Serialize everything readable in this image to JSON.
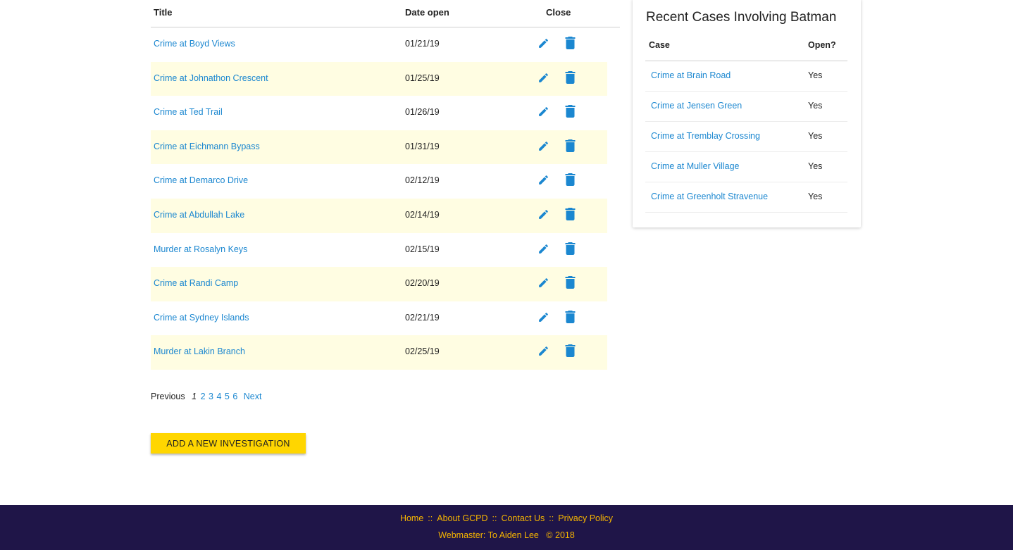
{
  "table": {
    "headers": {
      "title": "Title",
      "date": "Date open",
      "close": "Close"
    },
    "rows": [
      {
        "title": "Crime at Boyd Views",
        "date": "01/21/19"
      },
      {
        "title": "Crime at Johnathon Crescent",
        "date": "01/25/19"
      },
      {
        "title": "Crime at Ted Trail",
        "date": "01/26/19"
      },
      {
        "title": "Crime at Eichmann Bypass",
        "date": "01/31/19"
      },
      {
        "title": "Crime at Demarco Drive",
        "date": "02/12/19"
      },
      {
        "title": "Crime at Abdullah Lake",
        "date": "02/14/19"
      },
      {
        "title": "Murder at Rosalyn Keys",
        "date": "02/15/19"
      },
      {
        "title": "Crime at Randi Camp",
        "date": "02/20/19"
      },
      {
        "title": "Crime at Sydney Islands",
        "date": "02/21/19"
      },
      {
        "title": "Murder at Lakin Branch",
        "date": "02/25/19"
      }
    ],
    "icons": {
      "edit": "pencil-icon",
      "delete": "trash-icon"
    },
    "row_alt_color": "#fffde2",
    "icon_color": "#1b87d0"
  },
  "pagination": {
    "previous": "Previous",
    "current": "1",
    "pages": [
      "2",
      "3",
      "4",
      "5",
      "6"
    ],
    "next": "Next"
  },
  "add_button": {
    "label": "ADD A NEW INVESTIGATION",
    "color": "#ffd600"
  },
  "sidebar": {
    "title": "Recent Cases Involving Batman",
    "headers": {
      "case": "Case",
      "open": "Open?"
    },
    "rows": [
      {
        "case": "Crime at Brain Road",
        "open": "Yes"
      },
      {
        "case": "Crime at Jensen Green",
        "open": "Yes"
      },
      {
        "case": "Crime at Tremblay Crossing",
        "open": "Yes"
      },
      {
        "case": "Crime at Muller Village",
        "open": "Yes"
      },
      {
        "case": "Crime at Greenholt Stravenue",
        "open": "Yes"
      }
    ]
  },
  "footer": {
    "links": [
      "Home",
      "About GCPD",
      "Contact Us",
      "Privacy Policy"
    ],
    "separator": "::",
    "credit": "Webmaster: To Aiden Lee   © 2018",
    "background": "#1f1548",
    "text_color": "#f5b400"
  }
}
